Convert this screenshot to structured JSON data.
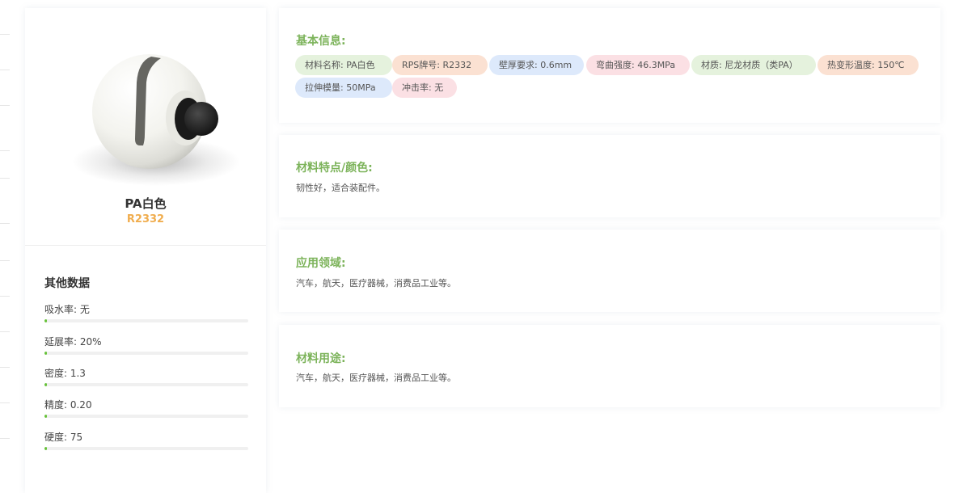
{
  "colors": {
    "accent_green": "#7cb35a",
    "code_orange": "#f0ad4e",
    "progress_green": "#67c23a",
    "tag_green": "#e5f2dd",
    "tag_orange": "#fbe1d2",
    "tag_blue": "#dde9fb",
    "tag_pink": "#fbe0e4"
  },
  "product": {
    "image_icon": "white-ball-product-image",
    "name": "PA白色",
    "code": "R2332"
  },
  "other_data": {
    "title": "其他数据",
    "items": [
      {
        "label": "吸水率: 无",
        "progress": 0.01
      },
      {
        "label": "延展率: 20%",
        "progress": 0.01
      },
      {
        "label": "密度: 1.3",
        "progress": 0.01
      },
      {
        "label": "精度: 0.20",
        "progress": 0.01
      },
      {
        "label": "硬度: 75",
        "progress": 0.01
      }
    ]
  },
  "basic_info": {
    "title": "基本信息:",
    "tags": [
      {
        "text": "材料名称: PA白色",
        "color": "#e5f2dd"
      },
      {
        "text": "RPS牌号: R2332",
        "color": "#fbe1d2"
      },
      {
        "text": "壁厚要求: 0.6mm",
        "color": "#dde9fb"
      },
      {
        "text": "弯曲强度: 46.3MPa",
        "color": "#fbe0e4"
      },
      {
        "text": "材质: 尼龙材质（类PA）",
        "color": "#e5f2dd"
      },
      {
        "text": "热变形温度: 150℃",
        "color": "#fbe1d2"
      },
      {
        "text": "拉伸模量: 50MPa",
        "color": "#dde9fb"
      },
      {
        "text": "冲击率: 无",
        "color": "#fbe0e4"
      }
    ]
  },
  "features": {
    "title": "材料特点/颜色:",
    "text": "韧性好，适合装配件。"
  },
  "applications": {
    "title": "应用领域:",
    "text": "汽车，航天，医疗器械，消费品工业等。"
  },
  "uses": {
    "title": "材料用途:",
    "text": "汽车，航天，医疗器械，消费品工业等。"
  }
}
